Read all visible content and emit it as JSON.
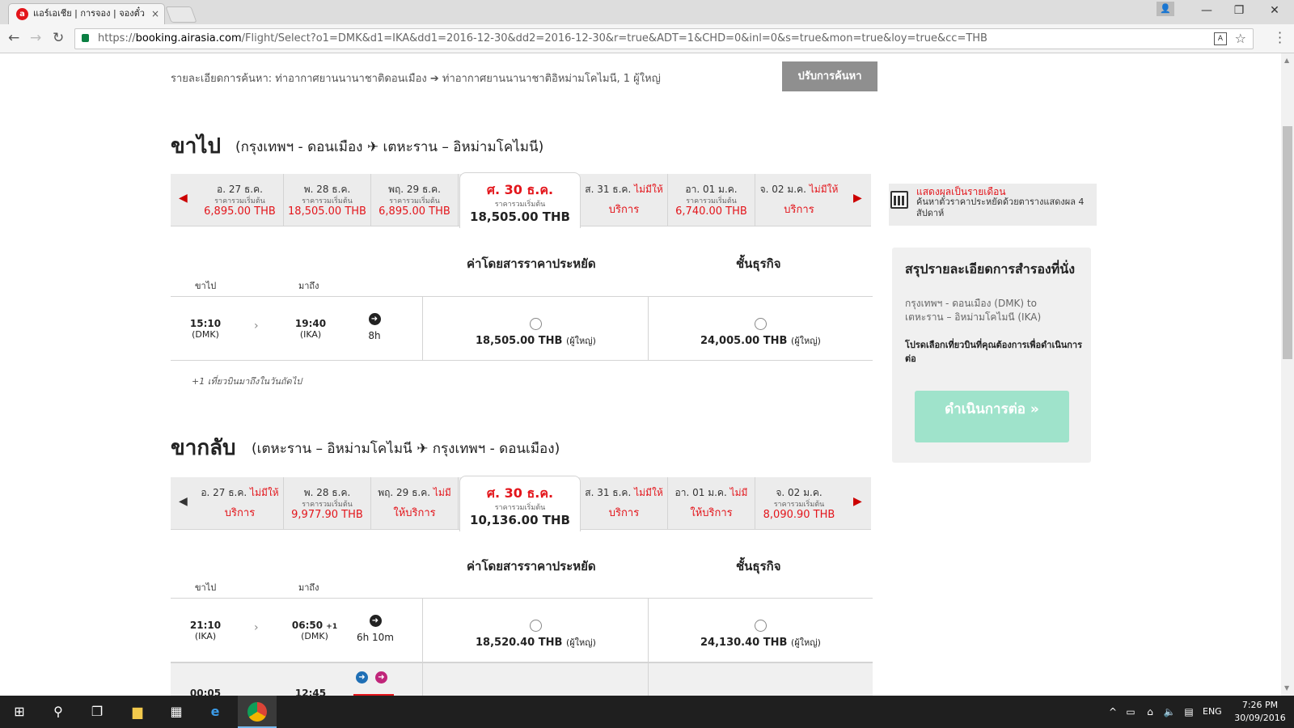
{
  "browser": {
    "tab_title": "แอร์เอเชีย | การจอง | จองตั๋ว",
    "tab_close": "×",
    "url_scheme": "https://",
    "url_host": "booking.airasia.com",
    "url_rest": "/Flight/Select?o1=DMK&d1=IKA&dd1=2016-12-30&dd2=2016-12-30&r=true&ADT=1&CHD=0&inl=0&s=true&mon=true&loy=true&cc=THB",
    "back": "←",
    "forward": "→",
    "reload": "↻",
    "minimize": "—",
    "restore": "❐",
    "close": "✕"
  },
  "search": {
    "summary": "รายละเอียดการค้นหา: ท่าอากาศยานนานาชาติดอนเมือง ➔ ท่าอากาศยานนานาชาติอิหม่ามโคไมนี, 1 ผู้ใหญ่",
    "refine_label": "ปรับการค้นหา"
  },
  "outbound": {
    "title": "ขาไป",
    "route": "(กรุงเทพฯ - ดอนเมือง  ✈  เตหะราน – อิหม่ามโคไมนี)",
    "days": [
      {
        "name": "อ. 27 ธ.ค.",
        "from": "ราคารวมเริ่มต้น",
        "price": "6,895.00 THB"
      },
      {
        "name": "พ. 28 ธ.ค.",
        "from": "ราคารวมเริ่มต้น",
        "price": "18,505.00 THB"
      },
      {
        "name": "พฤ. 29 ธ.ค.",
        "from": "ราคารวมเริ่มต้น",
        "price": "6,895.00 THB"
      },
      {
        "name": "ศ. 30 ธ.ค.",
        "from": "ราคารวมเริ่มต้น",
        "price": "18,505.00 THB"
      },
      {
        "name": "ส. 31 ธ.ค.",
        "na": "ไม่มีให้",
        "nobook": "บริการ"
      },
      {
        "name": "อา. 01 ม.ค.",
        "from": "ราคารวมเริ่มต้น",
        "price": "6,740.00 THB"
      },
      {
        "name": "จ. 02 ม.ค.",
        "na": "ไม่มีให้",
        "nobook": "บริการ"
      }
    ],
    "monthly_link": "แสดงผลเป็นรายเดือน",
    "monthly_desc": "ค้นหาตั๋วราคาประหยัดด้วยตารางแสดงผล 4 สัปดาห์",
    "economy_head": "ค่าโดยสารราคาประหยัด",
    "business_head": "ชั้นธุรกิจ",
    "depart_head": "ขาไป",
    "arrive_head": "มาถึง",
    "flights": [
      {
        "dep": "15:10",
        "dep_code": "(DMK)",
        "arr": "19:40",
        "arr_code": "(IKA)",
        "duration": "8h",
        "economy": "18,505.00 THB",
        "business": "24,005.00 THB",
        "pax": "(ผู้ใหญ่)"
      }
    ],
    "next_day_note": "+1 เที่ยวบินมาถึงในวันถัดไป"
  },
  "return": {
    "title": "ขากลับ",
    "route": "(เตหะราน – อิหม่ามโคไมนี  ✈  กรุงเทพฯ - ดอนเมือง)",
    "days": [
      {
        "name": "อ. 27 ธ.ค.",
        "na": "ไม่มีให้",
        "nobook": "บริการ"
      },
      {
        "name": "พ. 28 ธ.ค.",
        "from": "ราคารวมเริ่มต้น",
        "price": "9,977.90 THB"
      },
      {
        "name": "พฤ. 29 ธ.ค.",
        "na": "ไม่มี",
        "nobook": "ให้บริการ"
      },
      {
        "name": "ศ. 30 ธ.ค.",
        "from": "ราคารวมเริ่มต้น",
        "price": "10,136.00 THB"
      },
      {
        "name": "ส. 31 ธ.ค.",
        "na": "ไม่มีให้",
        "nobook": "บริการ"
      },
      {
        "name": "อา. 01 ม.ค.",
        "na": "ไม่มี",
        "nobook": "ให้บริการ"
      },
      {
        "name": "จ. 02 ม.ค.",
        "from": "ราคารวมเริ่มต้น",
        "price": "8,090.90 THB"
      }
    ],
    "economy_head": "ค่าโดยสารราคาประหยัด",
    "business_head": "ชั้นธุรกิจ",
    "depart_head": "ขาไป",
    "arrive_head": "มาถึง",
    "flights": [
      {
        "dep": "21:10",
        "dep_code": "(IKA)",
        "arr": "06:50",
        "arr_sup": "+1",
        "arr_code": "(DMK)",
        "duration": "6h 10m",
        "economy": "18,520.40 THB",
        "business": "24,130.40 THB",
        "pax": "(ผู้ใหญ่)"
      },
      {
        "dep": "00:05",
        "arr": "12:45"
      }
    ]
  },
  "summary": {
    "title": "สรุปรายละเอียดการสำรองที่นั่ง",
    "route": "กรุงเทพฯ - ดอนเมือง (DMK) to เตหะราน – อิหม่ามโคไมนี (IKA)",
    "note": "โปรดเลือกเที่ยวบินที่คุณต้องการเพื่อดำเนินการต่อ",
    "continue_label": "ดำเนินการต่อ »"
  },
  "taskbar": {
    "lang": "ENG",
    "time": "7:26 PM",
    "date": "30/09/2016"
  },
  "colors": {
    "brand_red": "#e3151b",
    "continue_disabled": "#9fe3cb",
    "refine_gray": "#8f8f8f"
  }
}
